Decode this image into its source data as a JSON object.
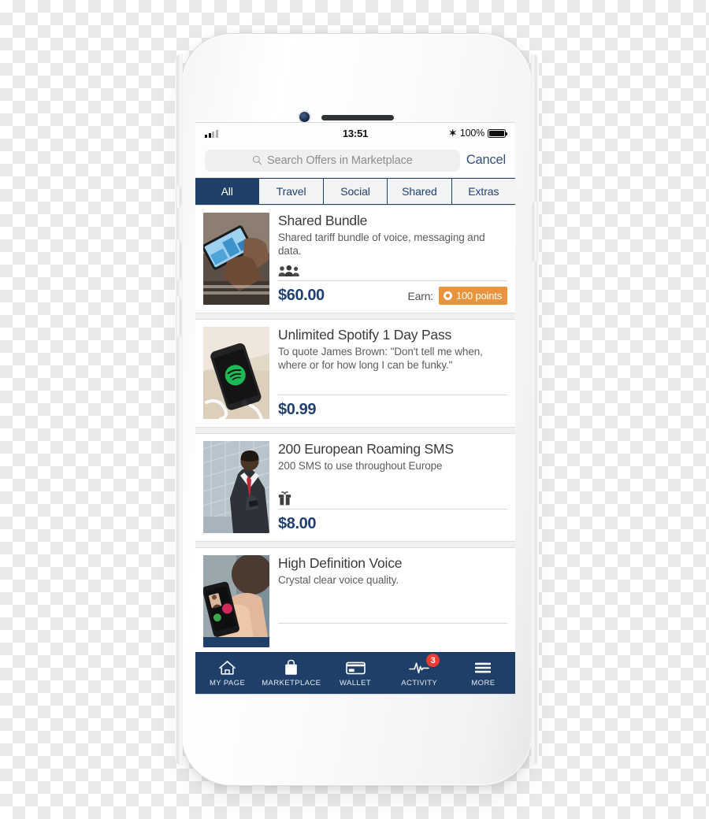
{
  "device": {
    "frame": "iphone-white",
    "camera_icon": "front-camera",
    "earpiece_icon": "earpiece-speaker"
  },
  "status_bar": {
    "signal_icon": "cellular-signal-icon",
    "time": "13:51",
    "bluetooth_icon": "bluetooth-icon",
    "bluetooth_glyph": "✶",
    "battery_percent": "100%",
    "battery_icon": "battery-full-icon"
  },
  "search": {
    "icon": "search-icon",
    "placeholder": "Search Offers in Marketplace",
    "value": "",
    "cancel_label": "Cancel"
  },
  "segmented_control": {
    "active_index": 0,
    "items": [
      {
        "label": "All",
        "active": true
      },
      {
        "label": "Travel",
        "active": false
      },
      {
        "label": "Social",
        "active": false
      },
      {
        "label": "Shared",
        "active": false
      },
      {
        "label": "Extras",
        "active": false
      }
    ]
  },
  "offers": [
    {
      "title": "Shared Bundle",
      "description": "Shared tariff bundle of voice, messaging and data.",
      "category_icon": "group-people-icon",
      "price": "$60.00",
      "earn_label": "Earn:",
      "points_badge": "100 points",
      "thumbnail": "hand-holding-smartphone-over-keyboard"
    },
    {
      "title": "Unlimited Spotify 1 Day Pass",
      "description": "To quote James Brown: \"Don't tell me when, where or for how long I can be funky.\"",
      "category_icon": "none",
      "price": "$0.99",
      "earn_label": "",
      "points_badge": "",
      "thumbnail": "black-phone-spotify-logo-on-desk"
    },
    {
      "title": "200 European Roaming SMS",
      "description": "200 SMS to use throughout Europe",
      "category_icon": "gift-icon",
      "price": "$8.00",
      "earn_label": "",
      "points_badge": "",
      "thumbnail": "businessman-in-suit-using-phone"
    },
    {
      "title": "High Definition Voice",
      "description": "Crystal clear voice quality.",
      "category_icon": "none",
      "price": "",
      "earn_label": "",
      "points_badge": "",
      "thumbnail": "hand-tapping-phone-incoming-call"
    }
  ],
  "tabbar": {
    "items": [
      {
        "label": "MY PAGE",
        "icon": "home-icon",
        "badge": ""
      },
      {
        "label": "MARKETPLACE",
        "icon": "bag-icon",
        "badge": ""
      },
      {
        "label": "WALLET",
        "icon": "card-icon",
        "badge": ""
      },
      {
        "label": "ACTIVITY",
        "icon": "pulse-icon",
        "badge": "3"
      },
      {
        "label": "MORE",
        "icon": "hamburger-icon",
        "badge": ""
      }
    ]
  },
  "colors": {
    "brand_navy": "#1d3f68",
    "price_navy": "#1f4272",
    "badge_orange": "#e8943f",
    "notification_red": "#ee3b33",
    "list_background": "#eef0f1"
  }
}
